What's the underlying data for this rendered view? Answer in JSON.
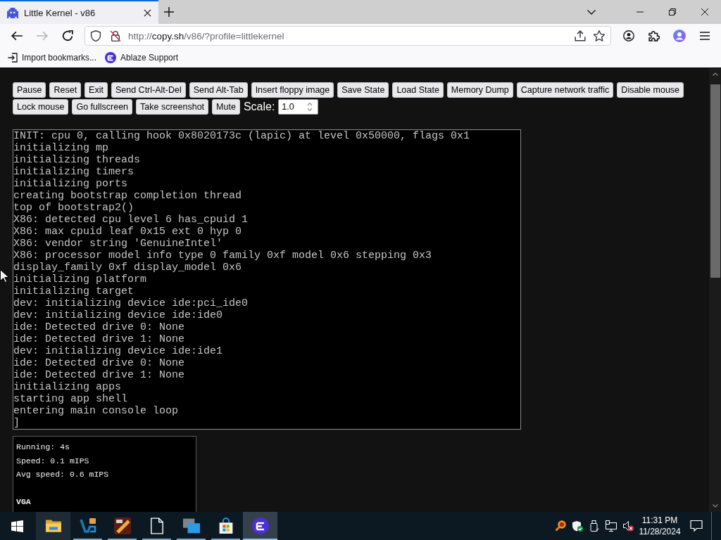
{
  "window": {
    "tabs": [
      {
        "title": "Little Kernel - v86",
        "selected": true
      }
    ]
  },
  "navigation": [
    {
      "kind": "back",
      "disabled": false
    },
    {
      "kind": "forward",
      "disabled": true
    },
    {
      "kind": "reload",
      "disabled": false
    }
  ],
  "address_bar": {
    "scheme": "http://",
    "host": "copy.sh",
    "path": "/v86/?profile=littlekernel",
    "secure": false
  },
  "bookmarks": [
    {
      "kind": "import",
      "label": "Import bookmarks..."
    },
    {
      "kind": "site",
      "label": "Ablaze Support"
    }
  ],
  "page": {
    "button_rows": [
      [
        "Pause",
        "Reset",
        "Exit",
        "Send Ctrl-Alt-Del",
        "Send Alt-Tab",
        "Insert floppy image",
        "Save State",
        "Load State",
        "Memory Dump",
        "Capture network traffic",
        "Disable mouse"
      ],
      [
        "Lock mouse",
        "Go fullscreen",
        "Take screenshot",
        "Mute"
      ]
    ],
    "scale": {
      "label": "Scale:",
      "value": "1.0"
    },
    "terminal": [
      "INIT: cpu 0, calling hook 0x8020173c (lapic) at level 0x50000, flags 0x1",
      "initializing mp",
      "initializing threads",
      "initializing timers",
      "initializing ports",
      "creating bootstrap completion thread",
      "top of bootstrap2()",
      "X86: detected cpu level 6 has_cpuid 1",
      "X86: max cpuid leaf 0x15 ext 0 hyp 0",
      "X86: vendor string 'GenuineIntel'",
      "X86: processor model info type 0 family 0xf model 0x6 stepping 0x3",
      "display_family 0xf display_model 0x6",
      "initializing platform",
      "initializing target",
      "dev: initializing device ide:pci_ide0",
      "dev: initializing device ide:ide0",
      "ide: Detected drive 0: None",
      "ide: Detected drive 1: None",
      "dev: initializing device ide:ide1",
      "ide: Detected drive 0: None",
      "ide: Detected drive 1: None",
      "initializing apps",
      "starting app shell",
      "entering main console loop",
      "]"
    ],
    "stats": {
      "lines": [
        "Running: 4s",
        "Speed: 0.1 mIPS",
        "Avg speed: 0.6 mIPS"
      ],
      "heading": "VGA"
    }
  },
  "taskbar": {
    "apps": [
      {
        "kind": "folder",
        "running": false,
        "hovered": true,
        "selected": false
      },
      {
        "kind": "v_logo",
        "running": true,
        "hovered": false,
        "selected": false
      },
      {
        "kind": "game",
        "running": true,
        "hovered": false,
        "selected": false
      },
      {
        "kind": "document",
        "running": true,
        "hovered": false,
        "selected": false
      },
      {
        "kind": "windows_stack",
        "running": true,
        "hovered": false,
        "selected": false
      },
      {
        "kind": "store",
        "running": true,
        "hovered": false,
        "selected": false
      },
      {
        "kind": "round_logo",
        "running": true,
        "hovered": false,
        "selected": true
      }
    ],
    "tray": {
      "muted": true
    },
    "clock": {
      "time": "11:31 PM",
      "date": "11/28/2024"
    }
  }
}
